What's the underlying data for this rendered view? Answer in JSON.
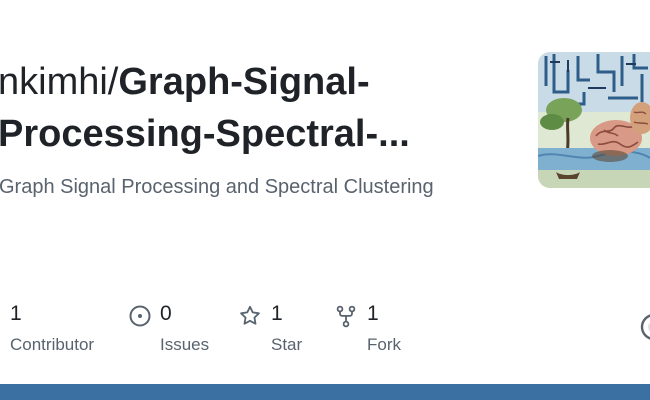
{
  "repo": {
    "owner": "nkimhi/",
    "name_line1": "Graph-Signal-",
    "name_line2": "Processing-Spectral-...",
    "description": "Graph Signal Processing and Spectral Clustering"
  },
  "stats": {
    "contributors": {
      "count": "1",
      "label": "Contributor",
      "icon": "people-icon"
    },
    "issues": {
      "count": "0",
      "label": "Issues",
      "icon": "issue-opened-icon"
    },
    "stars": {
      "count": "1",
      "label": "Star",
      "icon": "star-icon"
    },
    "forks": {
      "count": "1",
      "label": "Fork",
      "icon": "repo-forked-icon"
    }
  },
  "colors": {
    "text": "#1f2328",
    "muted": "#59636e",
    "bottom_bar": "#3b70a3"
  }
}
